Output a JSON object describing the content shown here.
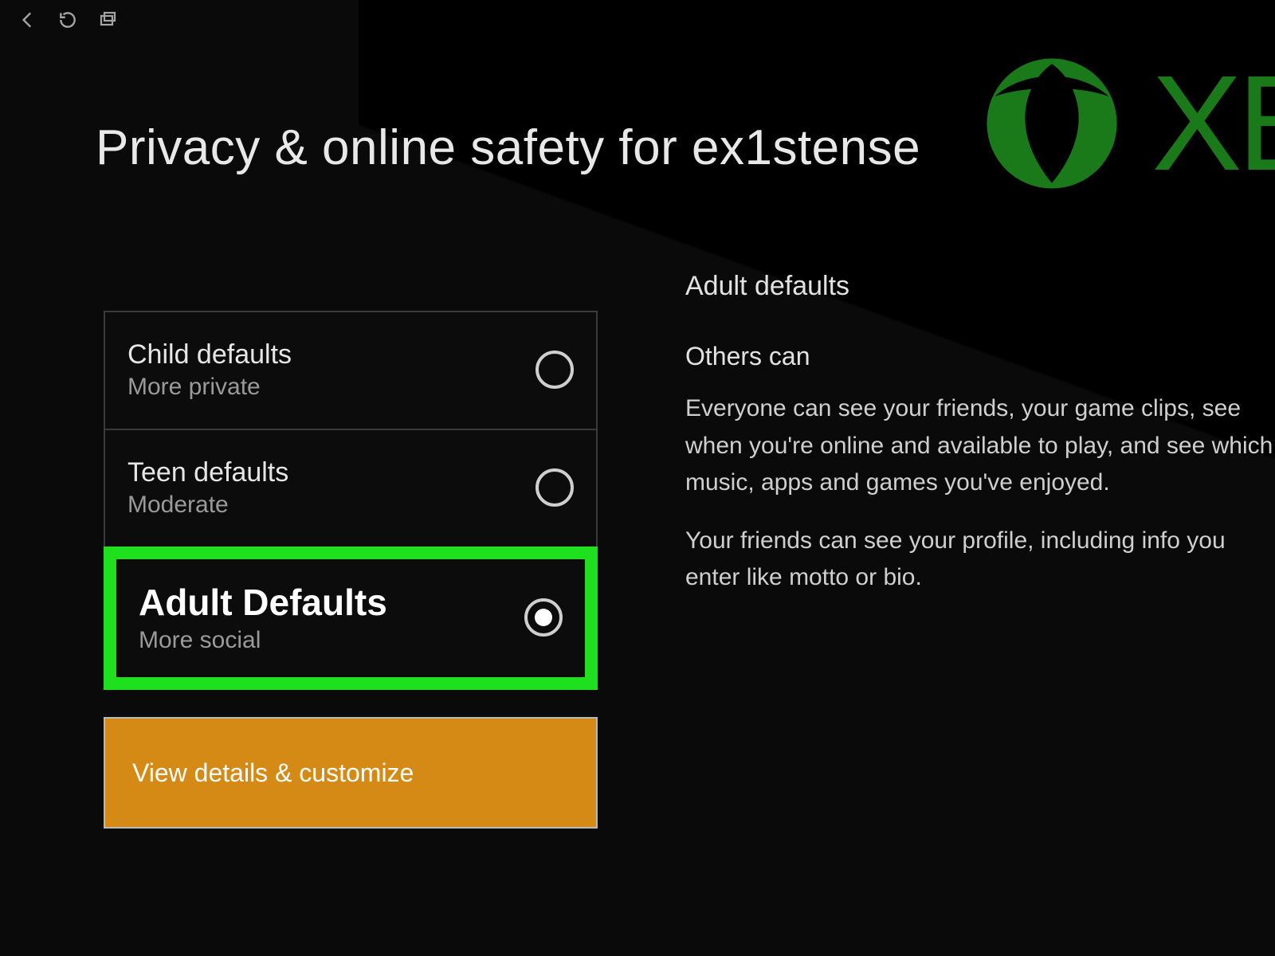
{
  "top": {
    "title": "Xbox"
  },
  "logo_text": "XB",
  "page_title": "Privacy & online safety for ex1stense",
  "options": [
    {
      "title": "Child defaults",
      "subtitle": "More private",
      "selected": false
    },
    {
      "title": "Teen defaults",
      "subtitle": "Moderate",
      "selected": false
    },
    {
      "title": "Adult Defaults",
      "subtitle": "More social",
      "selected": true
    }
  ],
  "customize_label": "View details & customize",
  "detail": {
    "heading": "Adult defaults",
    "subheading": "Others can",
    "para1": "Everyone can see your friends, your game clips, see when you're online and available to play, and see which music, apps and games you've enjoyed.",
    "para2": "Your friends can see your profile, including info you enter like motto or bio."
  }
}
